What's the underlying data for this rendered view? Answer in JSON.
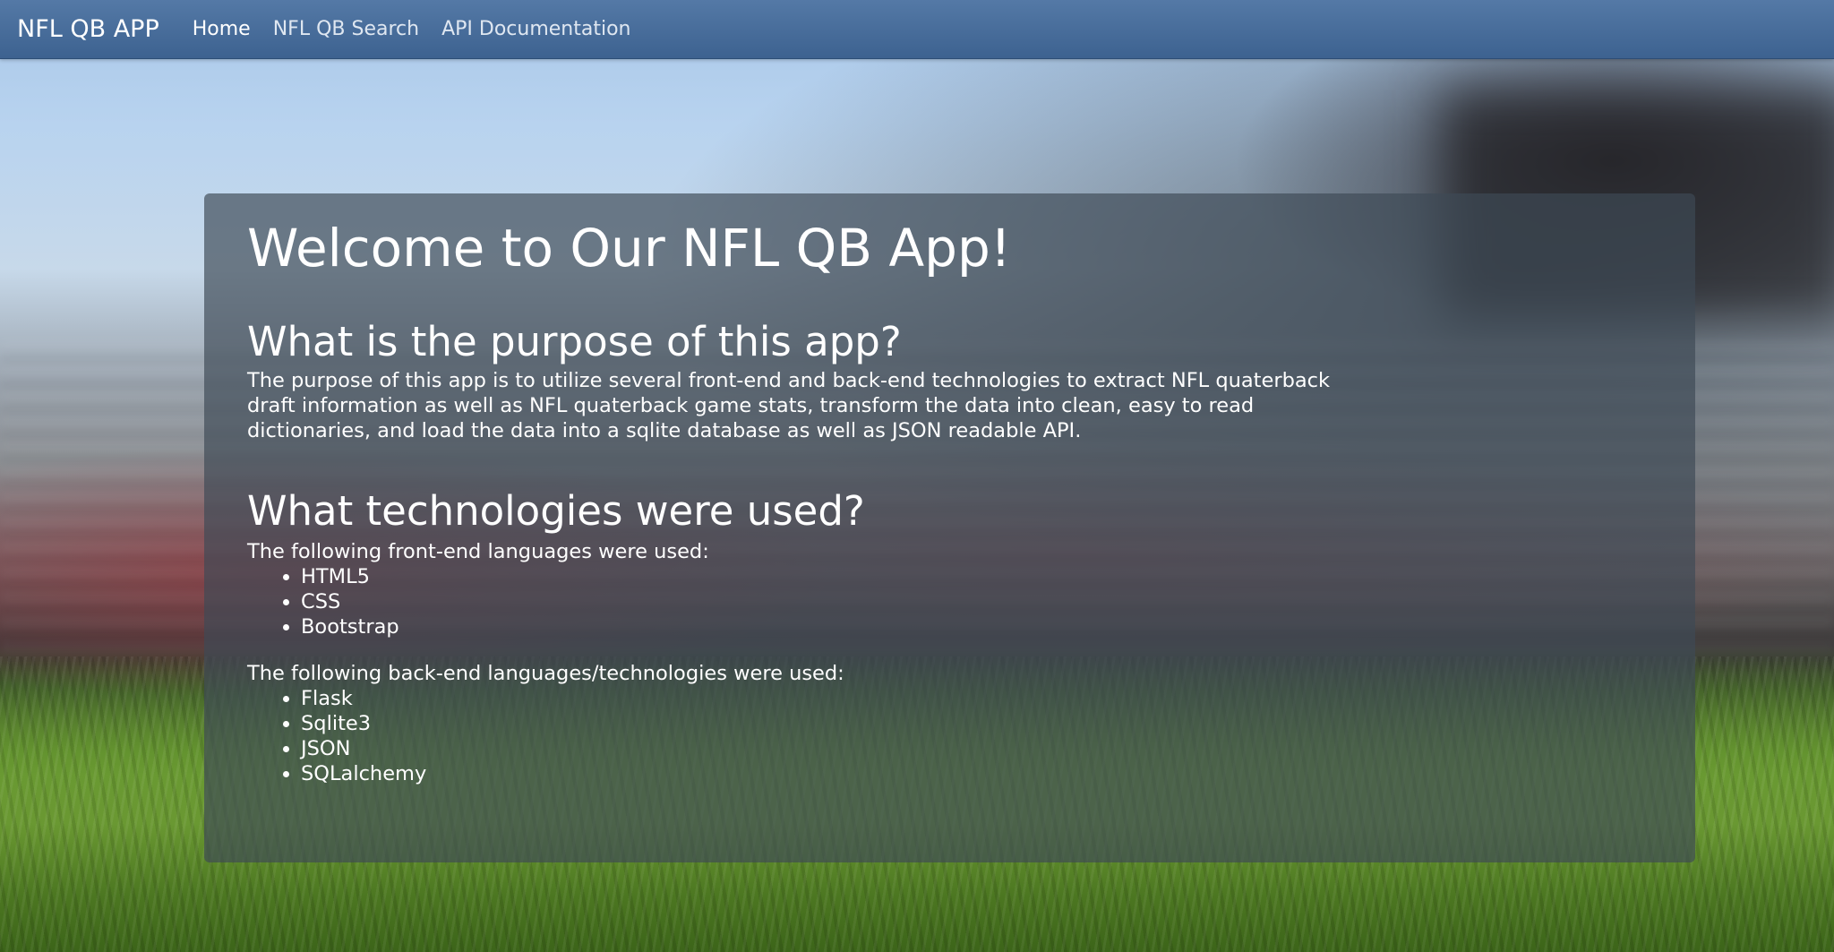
{
  "navbar": {
    "brand": "NFL QB APP",
    "links": [
      {
        "label": "Home",
        "active": true
      },
      {
        "label": "NFL QB Search",
        "active": false
      },
      {
        "label": "API Documentation",
        "active": false
      }
    ]
  },
  "main": {
    "title": "Welcome to Our NFL QB App!",
    "purpose": {
      "heading": "What is the purpose of this app?",
      "body": "The purpose of this app is to utilize several front-end and back-end technologies to extract NFL quaterback draft information as well as NFL quaterback game stats, transform the data into clean, easy to read dictionaries, and load the data into a sqlite database as well as JSON readable API."
    },
    "technologies": {
      "heading": "What technologies were used?",
      "frontend_intro": "The following front-end languages were used:",
      "frontend_items": [
        "HTML5",
        "CSS",
        "Bootstrap"
      ],
      "backend_intro": "The following back-end languages/technologies were used:",
      "backend_items": [
        "Flask",
        "Sqlite3",
        "JSON",
        "SQLalchemy"
      ]
    }
  },
  "colors": {
    "navbar_top": "#5479a6",
    "navbar_bottom": "#3d6290",
    "panel_bg": "rgba(62, 74, 86, 0.68)",
    "text": "#ffffff"
  }
}
